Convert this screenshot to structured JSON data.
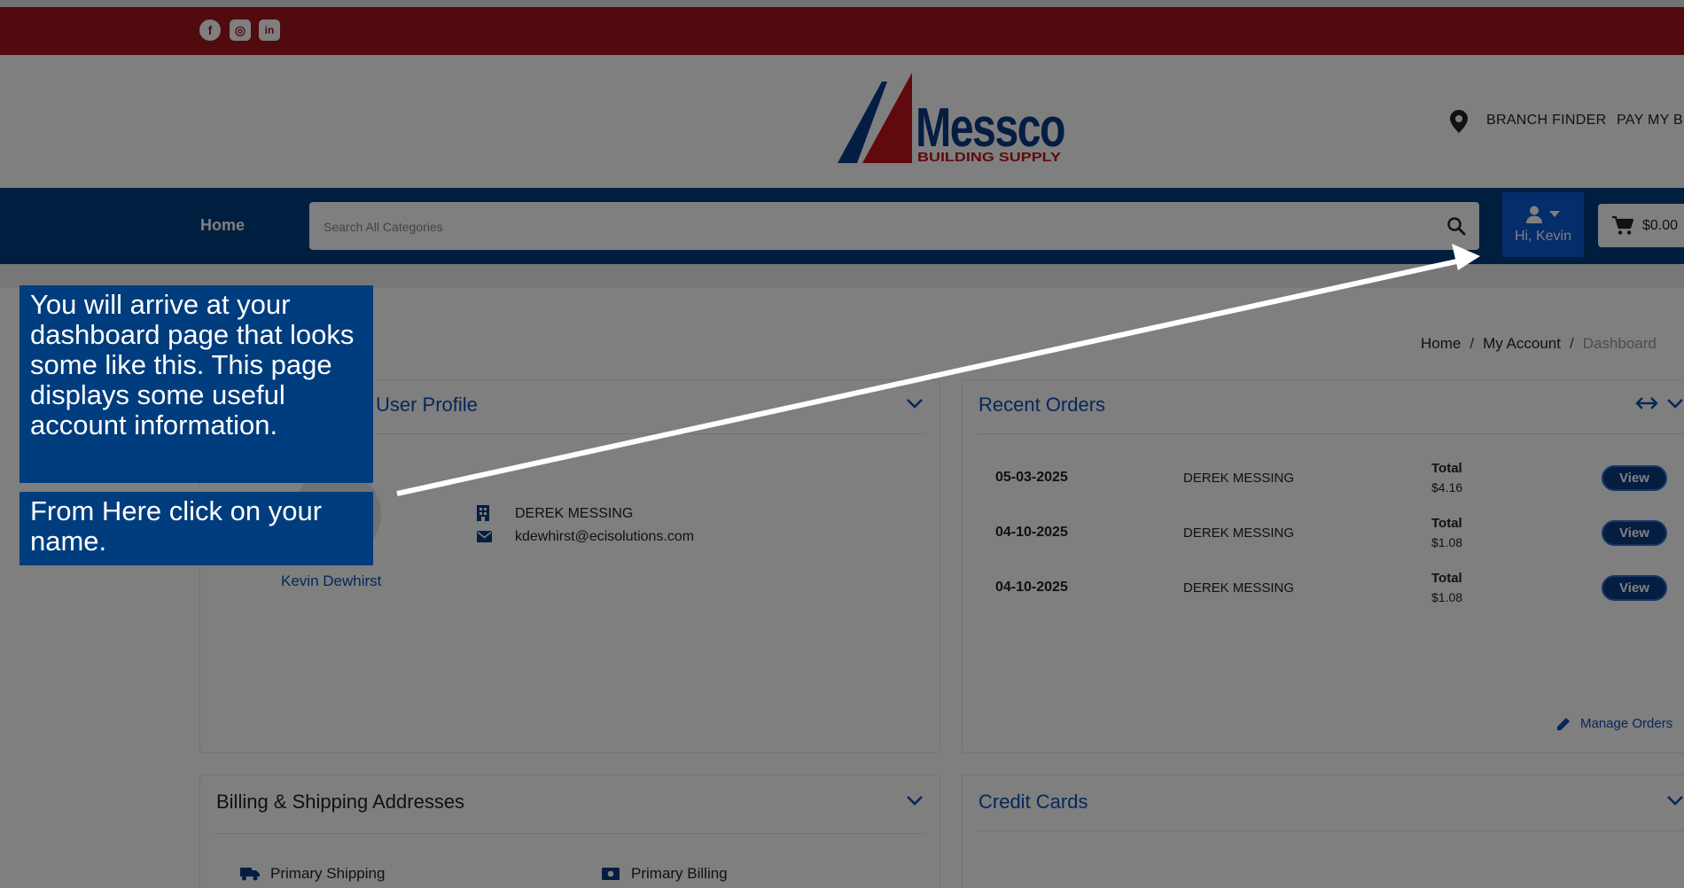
{
  "social": {
    "icons": [
      "facebook-icon",
      "instagram-icon",
      "linkedin-icon"
    ],
    "facebook_glyph": "f",
    "instagram_glyph": "◎",
    "linkedin_glyph": "in"
  },
  "logo": {
    "name": "Messco",
    "tagline": "BUILDING SUPPLY"
  },
  "header": {
    "branch_finder": "BRANCH FINDER",
    "pay_my_bill": "PAY MY B"
  },
  "nav": {
    "home": "Home",
    "search_placeholder": "Search All Categories",
    "greeting": "Hi, Kevin",
    "cart_total": "$0.00"
  },
  "breadcrumb": {
    "items": [
      "Home",
      "My Account",
      "Dashboard"
    ]
  },
  "profile": {
    "title": "User Profile",
    "company": "DEREK MESSING",
    "email": "kdewhirst@ecisolutions.com",
    "name": "Kevin Dewhirst"
  },
  "orders": {
    "title": "Recent Orders",
    "rows": [
      {
        "date": "05-03-2025",
        "customer": "DEREK MESSING",
        "total_label": "Total",
        "total": "$4.16",
        "action": "View"
      },
      {
        "date": "04-10-2025",
        "customer": "DEREK MESSING",
        "total_label": "Total",
        "total": "$1.08",
        "action": "View"
      },
      {
        "date": "04-10-2025",
        "customer": "DEREK MESSING",
        "total_label": "Total",
        "total": "$1.08",
        "action": "View"
      }
    ],
    "manage": "Manage Orders"
  },
  "billing": {
    "title": "Billing & Shipping Addresses",
    "primary_shipping": "Primary Shipping",
    "primary_billing": "Primary Billing"
  },
  "credit_cards": {
    "title": "Credit Cards"
  },
  "callouts": {
    "first": "You will arrive at your dashboard page that looks some like this. This page displays some useful account information.",
    "second": "From Here click on your name."
  },
  "colors": {
    "social_bar": "#a3141a",
    "nav_bar": "#003d7e",
    "account_button": "#0b5ad7",
    "link_blue": "#0b4fb3",
    "callout_bg": "#003d7e"
  }
}
